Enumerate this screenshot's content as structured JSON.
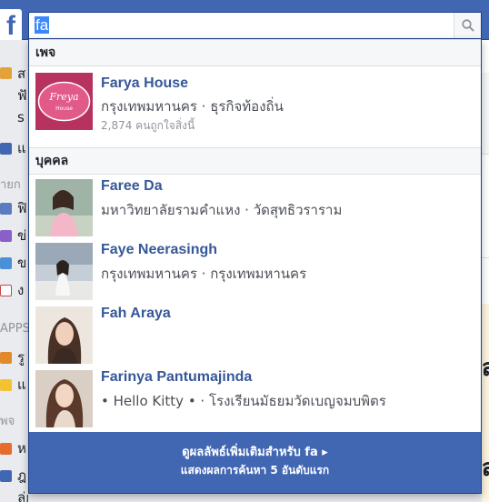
{
  "header": {
    "logo_letter": "f",
    "search": {
      "value": "fa",
      "icon": "search-icon"
    }
  },
  "background": {
    "left_texts": [
      "ส",
      "ฟั",
      "s",
      "แ",
      "ายก",
      "ฟิ",
      "ข่",
      "ข",
      "ง",
      "APPS",
      "รู",
      "แ",
      "พจ",
      "ห",
      "ฎ",
      "ลู่ก.มทว"
    ],
    "right_fragments": [
      "ส",
      "ส"
    ]
  },
  "dropdown": {
    "sections": [
      {
        "title": "เพจ",
        "results": [
          {
            "name": "Farya House",
            "subtitle": "กรุงเทพมหานคร · ธุรกิจท้องถิ่น",
            "meta": "2,874 คนถูกใจสิ่งนี้",
            "thumb_text": "Freya House"
          }
        ]
      },
      {
        "title": "บุคคล",
        "results": [
          {
            "name": "Faree Da",
            "subtitle": "มหาวิทยาลัยรามคำแหง · วัดสุทธิวราราม"
          },
          {
            "name": "Faye Neerasingh",
            "subtitle": "กรุงเทพมหานคร · กรุงเทพมหานคร"
          },
          {
            "name": "Fah Araya",
            "subtitle": ""
          },
          {
            "name": "Farinya Pantumajinda",
            "subtitle": "• Hello Kitty • · โรงเรียนมัธยมวัดเบญจมบพิตร"
          }
        ]
      }
    ],
    "see_more": {
      "label": "ดูผลลัพธ์เพิ่มเติมสำหรับ fa ▸",
      "sublabel": "แสดงผลการค้นหา 5 อันดับแรก"
    }
  },
  "colors": {
    "brand": "#4267b2",
    "link": "#365899",
    "muted": "#90949c"
  }
}
